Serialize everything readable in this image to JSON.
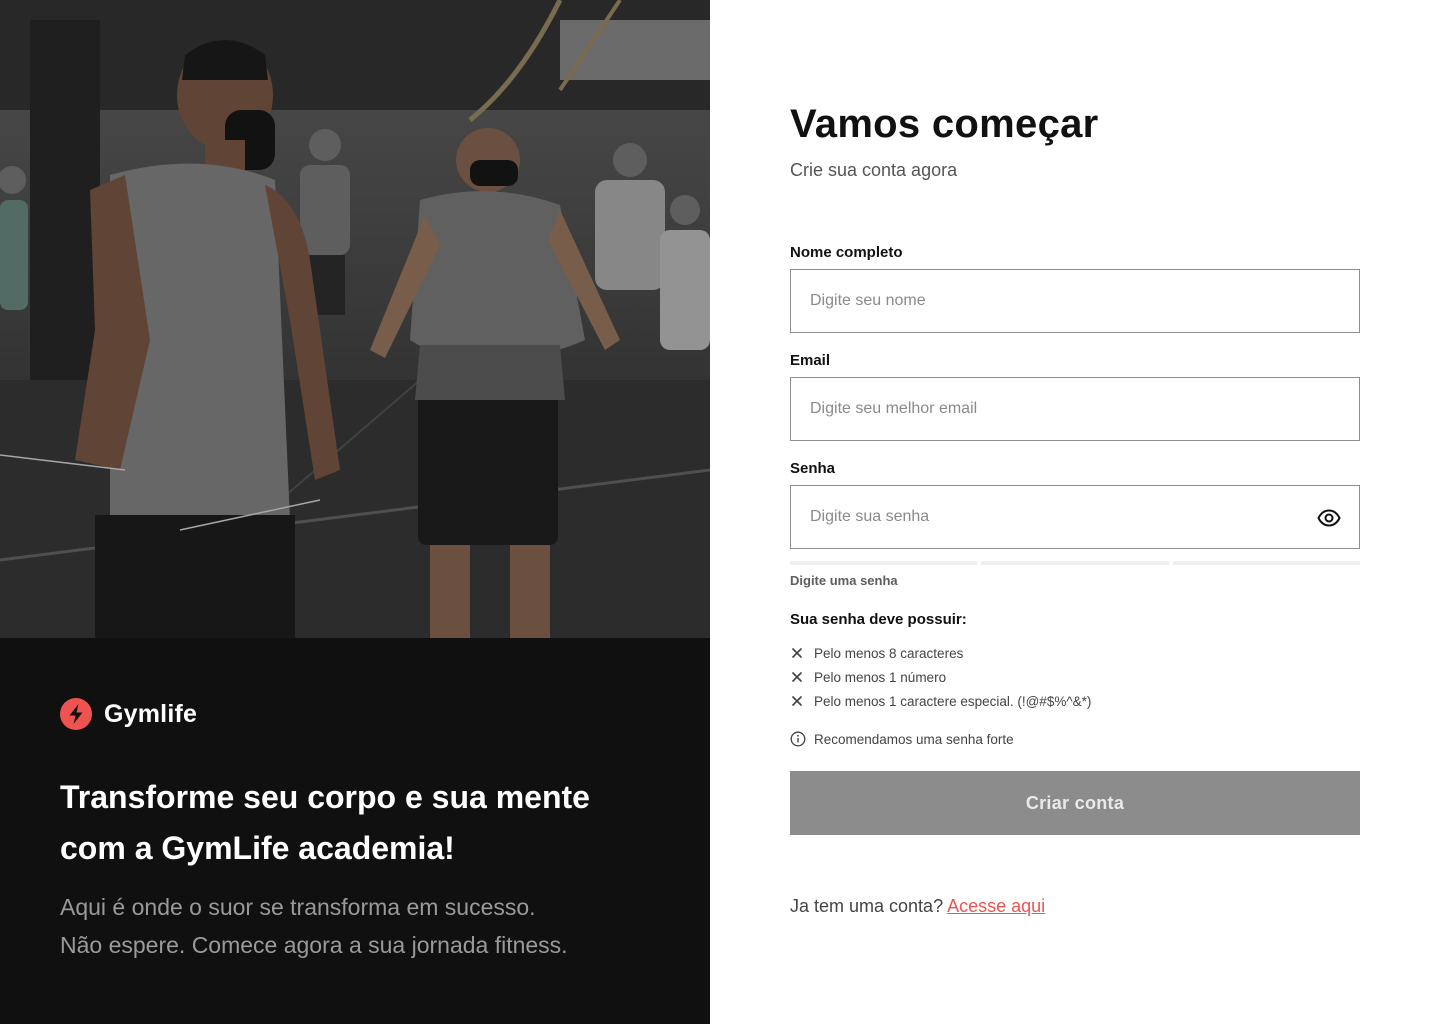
{
  "left": {
    "brand_name": "Gymlife",
    "headline_line1": "Transforme seu corpo e sua mente",
    "headline_line2": "com a GymLife academia!",
    "subline_line1": "Aqui é onde o suor se transforma em sucesso.",
    "subline_line2": "Não espere. Comece agora a sua jornada fitness."
  },
  "form": {
    "title": "Vamos começar",
    "subtitle": "Crie sua conta agora",
    "name_label": "Nome completo",
    "name_placeholder": "Digite seu nome",
    "name_value": "",
    "email_label": "Email",
    "email_placeholder": "Digite seu melhor email",
    "email_value": "",
    "password_label": "Senha",
    "password_placeholder": "Digite sua senha",
    "password_value": "",
    "strength_text": "Digite uma senha",
    "requirements_title": "Sua senha deve possuir:",
    "requirements": [
      "Pelo menos 8 caracteres",
      "Pelo menos 1 número",
      "Pelo menos 1 caractere especial. (!@#$%^&*)"
    ],
    "recommendation": "Recomendamos uma senha forte",
    "submit_label": "Criar conta",
    "login_prompt": "Ja tem uma conta?",
    "login_link": "Acesse aqui"
  },
  "colors": {
    "accent": "#ef5350",
    "button_disabled": "#8c8c8c",
    "left_panel_bg": "#101010"
  },
  "icons": {
    "brand": "lightning-bolt-icon",
    "password_toggle": "eye-icon",
    "requirement_status": "close-icon",
    "recommendation": "info-icon"
  }
}
